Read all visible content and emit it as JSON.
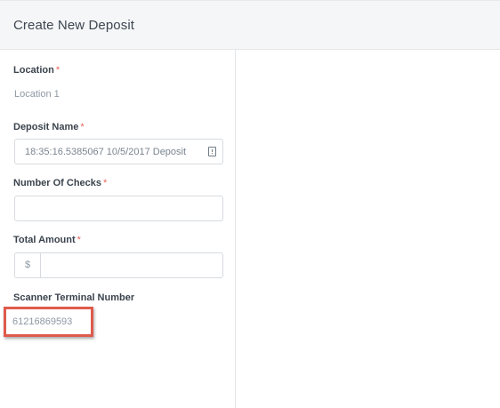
{
  "header": {
    "title": "Create New Deposit"
  },
  "form": {
    "location": {
      "label": "Location",
      "required_mark": "*",
      "value": "Location 1"
    },
    "deposit_name": {
      "label": "Deposit Name",
      "required_mark": "*",
      "value": "18:35:16.5385067 10/5/2017 Deposit",
      "icon": "document-alert-icon"
    },
    "number_of_checks": {
      "label": "Number Of Checks",
      "required_mark": "*",
      "value": ""
    },
    "total_amount": {
      "label": "Total Amount",
      "required_mark": "*",
      "currency_prefix": "$",
      "value": ""
    },
    "scanner_terminal_number": {
      "label": "Scanner Terminal Number",
      "value": "61216869593"
    }
  },
  "colors": {
    "required": "#e8665c",
    "highlight": "#e05a4c",
    "header_bg": "#f5f6f8"
  }
}
